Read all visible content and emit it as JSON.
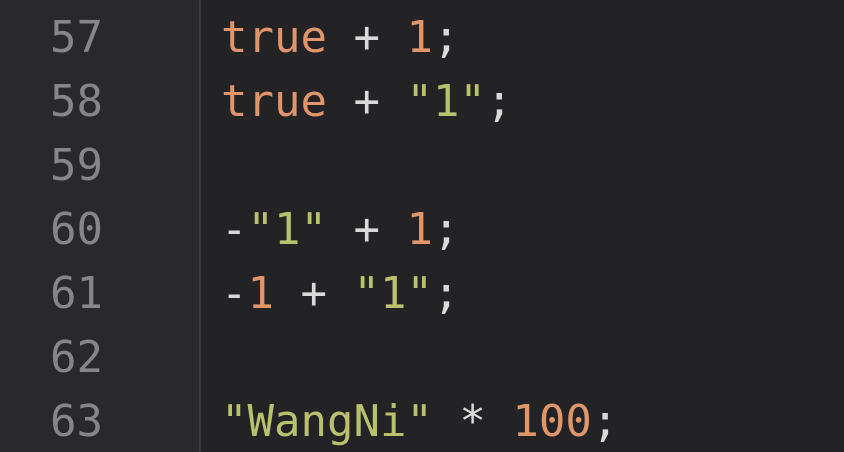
{
  "editor": {
    "colors": {
      "background": "#232326",
      "gutter": "#29292c",
      "line_number": "#86868a",
      "keyword": "#e0956a",
      "number": "#e0956a",
      "string": "#b9c16d",
      "text": "#d9d9d9"
    },
    "lines": [
      {
        "number": "57",
        "tokens": [
          {
            "type": "keyword",
            "text": "true"
          },
          {
            "type": "op",
            "text": " + "
          },
          {
            "type": "number",
            "text": "1"
          },
          {
            "type": "punct",
            "text": ";"
          }
        ]
      },
      {
        "number": "58",
        "tokens": [
          {
            "type": "keyword",
            "text": "true"
          },
          {
            "type": "op",
            "text": " + "
          },
          {
            "type": "string",
            "text": "\"1\""
          },
          {
            "type": "punct",
            "text": ";"
          }
        ]
      },
      {
        "number": "59",
        "tokens": []
      },
      {
        "number": "60",
        "tokens": [
          {
            "type": "op",
            "text": "-"
          },
          {
            "type": "string",
            "text": "\"1\""
          },
          {
            "type": "op",
            "text": " + "
          },
          {
            "type": "number",
            "text": "1"
          },
          {
            "type": "punct",
            "text": ";"
          }
        ]
      },
      {
        "number": "61",
        "tokens": [
          {
            "type": "op",
            "text": "-"
          },
          {
            "type": "number",
            "text": "1"
          },
          {
            "type": "op",
            "text": " + "
          },
          {
            "type": "string",
            "text": "\"1\""
          },
          {
            "type": "punct",
            "text": ";"
          }
        ]
      },
      {
        "number": "62",
        "tokens": []
      },
      {
        "number": "63",
        "tokens": [
          {
            "type": "string",
            "text": "\"WangNi\""
          },
          {
            "type": "op",
            "text": " * "
          },
          {
            "type": "number",
            "text": "100"
          },
          {
            "type": "punct",
            "text": ";"
          }
        ]
      }
    ]
  }
}
